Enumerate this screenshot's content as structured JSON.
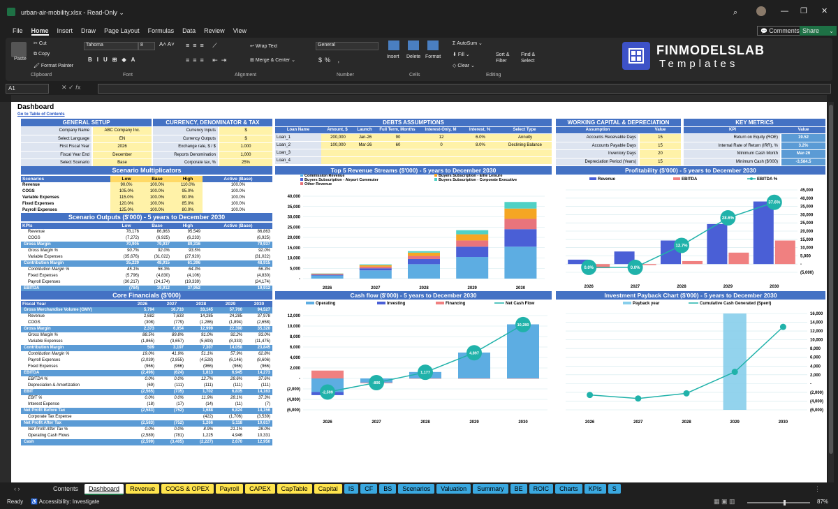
{
  "app": {
    "filename": "urban-air-mobility.xlsx",
    "mode": "Read-Only",
    "comments": "Comments",
    "share": "Share"
  },
  "menu": [
    "File",
    "Home",
    "Insert",
    "Draw",
    "Page Layout",
    "Formulas",
    "Data",
    "Review",
    "View"
  ],
  "ribbon": {
    "paste": "Paste",
    "cut": "Cut",
    "copy": "Copy",
    "format_painter": "Format Painter",
    "clipboard": "Clipboard",
    "font_name": "Tahoma",
    "font_size": "8",
    "font": "Font",
    "wrap": "Wrap Text",
    "merge": "Merge & Center",
    "alignment": "Alignment",
    "numfmt": "General",
    "number": "Number",
    "insert": "Insert",
    "delete": "Delete",
    "format": "Format",
    "cells": "Cells",
    "autosum": "AutoSum",
    "fill": "Fill",
    "clear": "Clear",
    "sort": "Sort & Filter",
    "find": "Find & Select",
    "editing": "Editing",
    "logo1": "FINMODELSLAB",
    "logo2": "Templates"
  },
  "formula": {
    "cellref": "A1"
  },
  "sheet": {
    "title": "Dashboard",
    "toc": "Go to Table of Contents",
    "gen_setup": {
      "title": "GENERAL SETUP",
      "rows": [
        [
          "Company Name",
          "ABC Company Inc."
        ],
        [
          "Select Language",
          "EN"
        ],
        [
          "First Fiscal Year",
          "2026"
        ],
        [
          "Fiscal Year End",
          "December"
        ],
        [
          "Select Scenario",
          "Base"
        ]
      ]
    },
    "currency": {
      "title": "CURRENCY, DENOMINATOR & TAX",
      "rows": [
        [
          "Currency Inputs",
          "$"
        ],
        [
          "Currency Outputs",
          "$"
        ],
        [
          "Exchange rate, $ / $",
          "1.000"
        ],
        [
          "Reports Denomination",
          "1,000"
        ],
        [
          "Corporate tax, %",
          "25%"
        ]
      ]
    },
    "debts": {
      "title": "DEBTS ASSUMPTIONS",
      "headers": [
        "Loan Name",
        "Amount, $",
        "Launch",
        "Full Term, Months",
        "Interest-Only, M",
        "Interest, %",
        "Select Type"
      ],
      "rows": [
        [
          "Loan_1",
          "200,000",
          "Jan-26",
          "90",
          "12",
          "6.0%",
          "Annuity"
        ],
        [
          "Loan_2",
          "100,000",
          "Mar-26",
          "60",
          "0",
          "8.0%",
          "Declining Balance"
        ],
        [
          "Loan_3",
          "",
          "",
          "",
          "",
          "",
          ""
        ],
        [
          "Loan_4",
          "",
          "",
          "",
          "",
          "",
          ""
        ]
      ]
    },
    "wc": {
      "title": "WORKING CAPITAL & DEPRECIATION",
      "headers": [
        "Assumption",
        "Value"
      ],
      "rows": [
        [
          "Accounts Receivable Days",
          "15"
        ],
        [
          "Accounts Payable Days",
          "15"
        ],
        [
          "Inventory Days",
          "20"
        ],
        [
          "Depreciation Period (Years)",
          "15"
        ]
      ]
    },
    "km": {
      "title": "KEY METRICS",
      "headers": [
        "KPI",
        "Value"
      ],
      "rows": [
        [
          "Return on Equity (ROE)",
          "19.52"
        ],
        [
          "Internal Rate of Return (IRR), %",
          "3.2%"
        ],
        [
          "Minimum Cash Month",
          "Mar-26"
        ],
        [
          "Minimum Cash ($'000)",
          "-3,584.5"
        ]
      ]
    },
    "sm": {
      "title": "Scenario Multiplicators",
      "headers": [
        "Scenarios",
        "Low",
        "Base",
        "High",
        "Active (Base)"
      ],
      "rows": [
        [
          "Revenue",
          "90.0%",
          "100.0%",
          "110.0%",
          "100.0%"
        ],
        [
          "COGS",
          "105.0%",
          "100.0%",
          "95.0%",
          "100.0%"
        ],
        [
          "Variable Expenses",
          "115.0%",
          "100.0%",
          "90.0%",
          "100.0%"
        ],
        [
          "Fixed Expenses",
          "120.0%",
          "100.0%",
          "85.0%",
          "100.0%"
        ],
        [
          "Payroll Expenses",
          "125.0%",
          "100.0%",
          "80.0%",
          "100.0%"
        ]
      ]
    },
    "so": {
      "title": "Scenario Outputs ($'000) - 5 years to December 2030",
      "headers": [
        "KPIs",
        "Low",
        "Base",
        "High",
        "Active (Base)"
      ],
      "rows": [
        [
          "Revenue",
          "78,176",
          "86,863",
          "95,549",
          "86,863",
          0
        ],
        [
          "COGS",
          "(7,272)",
          "(6,925)",
          "(6,233)",
          "(6,925)",
          0
        ],
        [
          "Gross Margin",
          "70,905",
          "79,937",
          "89,316",
          "79,937",
          1
        ],
        [
          "Gross Margin %",
          "90.7%",
          "92.0%",
          "93.5%",
          "92.0%",
          0
        ],
        [
          "Variable Expenses",
          "(35,676)",
          "(31,022)",
          "(27,920)",
          "(31,022)",
          0
        ],
        [
          "Contribution Margin",
          "35,229",
          "48,915",
          "61,396",
          "48,915",
          1
        ],
        [
          "Contribution Margin %",
          "45.1%",
          "56.3%",
          "64.3%",
          "56.3%",
          0
        ],
        [
          "Fixed Expenses",
          "(5,796)",
          "(4,830)",
          "(4,106)",
          "(4,830)",
          0
        ],
        [
          "Payroll Expenses",
          "(30,217)",
          "(24,174)",
          "(19,339)",
          "(24,174)",
          0
        ],
        [
          "EBITDA",
          "(784)",
          "19,912",
          "37,952",
          "19,912",
          1
        ],
        [
          "EBITDA %",
          "-1.0%",
          "22.9%",
          "39.7%",
          "22.9%",
          0
        ]
      ]
    },
    "cf": {
      "title": "Core Financials ($'000)",
      "headers": [
        "Fiscal Year",
        "2026",
        "2027",
        "2028",
        "2029",
        "2030"
      ],
      "rows": [
        [
          "Gross Merchandise Volume (GMV)",
          "5,794",
          "16,733",
          "33,145",
          "57,700",
          "94,527",
          1
        ],
        [
          "Revenue",
          "2,682",
          "7,633",
          "14,285",
          "24,285",
          "37,978",
          0
        ],
        [
          "COGS",
          "(308)",
          "(779)",
          "(1,286)",
          "(1,894)",
          "(2,658)",
          0
        ],
        [
          "Gross Margin",
          "2,373",
          "6,854",
          "12,999",
          "22,390",
          "35,320",
          1
        ],
        [
          "Gross Margin %",
          "88.5%",
          "89.8%",
          "91.0%",
          "92.2%",
          "93.0%",
          0
        ],
        [
          "Variable Expenses",
          "(1,865)",
          "(3,657)",
          "(5,693)",
          "(8,333)",
          "(11,475)",
          0
        ],
        [
          "Contribution Margin",
          "509",
          "3,197",
          "7,307",
          "14,058",
          "23,845",
          1
        ],
        [
          "Contribution Margin %",
          "19.0%",
          "41.9%",
          "51.1%",
          "57.9%",
          "62.8%",
          0
        ],
        [
          "Payroll Expenses",
          "(2,039)",
          "(2,855)",
          "(4,528)",
          "(6,146)",
          "(8,606)",
          0
        ],
        [
          "Fixed Expenses",
          "(966)",
          "(966)",
          "(966)",
          "(966)",
          "(966)",
          0
        ],
        [
          "EBITDA",
          "(2,496)",
          "(624)",
          "1,813",
          "6,945",
          "14,273",
          1
        ],
        [
          "EBITDA %",
          "0.0%",
          "0.0%",
          "12.7%",
          "28.6%",
          "37.6%",
          0
        ],
        [
          "Depreciation & Amortization",
          "(69)",
          "(111)",
          "(111)",
          "(111)",
          "(111)",
          0
        ],
        [
          "EBIT",
          "(2,565)",
          "(735)",
          "1,702",
          "6,835",
          "14,163",
          1
        ],
        [
          "EBIT %",
          "0.0%",
          "0.0%",
          "11.9%",
          "28.1%",
          "37.3%",
          0
        ],
        [
          "Interest Expense",
          "(18)",
          "(17)",
          "(14)",
          "(11)",
          "(7)",
          0
        ],
        [
          "Net Profit Before Tax",
          "(2,583)",
          "(752)",
          "1,688",
          "6,824",
          "14,156",
          1
        ],
        [
          "Corporate Tax Expense",
          "",
          "",
          "(422)",
          "(1,706)",
          "(3,539)",
          0
        ],
        [
          "Net Profit After Tax",
          "(2,583)",
          "(752)",
          "1,266",
          "5,118",
          "10,617",
          1
        ],
        [
          "Net Profit After Tax %",
          "0.0%",
          "0.0%",
          "8.9%",
          "21.1%",
          "28.0%",
          0
        ],
        [
          "Operating Cash Flows",
          "(2,589)",
          "(781)",
          "1,225",
          "4,946",
          "10,331",
          0
        ],
        [
          "Cash",
          "(2,599)",
          "(3,405)",
          "(2,227)",
          "2,670",
          "12,950",
          1
        ]
      ]
    }
  },
  "tabs": [
    "Contents",
    "Dashboard",
    "Revenue",
    "COGS & OPEX",
    "Payroll",
    "CAPEX",
    "CapTable",
    "Capital",
    "IS",
    "CF",
    "BS",
    "Scenarios",
    "Valuation",
    "Summary",
    "BE",
    "ROIC",
    "Charts",
    "KPIs",
    "S"
  ],
  "status": {
    "ready": "Ready",
    "access": "Accessibility: Investigate",
    "zoom": "87%"
  },
  "chart_data": [
    {
      "type": "bar",
      "title": "Top 5 Revenue Streams ($'000) - 5 years to December 2030",
      "categories": [
        "2026",
        "2027",
        "2028",
        "2029",
        "2030"
      ],
      "ylim": [
        0,
        40000
      ],
      "yticks": [
        "40,000",
        "35,000",
        "30,000",
        "25,000",
        "20,000",
        "15,000",
        "10,000",
        "5,000",
        "-"
      ],
      "series": [
        {
          "name": "Commission Revenue",
          "color": "#5dade2",
          "values": [
            1500,
            4000,
            7000,
            10500,
            15500
          ]
        },
        {
          "name": "Buyers Subscription - Airport Commuter",
          "color": "#4a5fd6",
          "values": [
            400,
            1000,
            2500,
            5000,
            8500
          ]
        },
        {
          "name": "Other Revenue",
          "color": "#e8747c",
          "values": [
            300,
            800,
            1500,
            3000,
            5000
          ]
        },
        {
          "name": "Buyers Subscription - Elite Leisure",
          "color": "#f5a623",
          "values": [
            200,
            700,
            1600,
            3000,
            5000
          ]
        },
        {
          "name": "Buyers Subscription - Corporate Executive",
          "color": "#4fd1c5",
          "values": [
            100,
            400,
            700,
            2000,
            3200
          ]
        }
      ]
    },
    {
      "type": "bar",
      "title": "Profitability ($'000) - 5 years to December 2030",
      "categories": [
        "2026",
        "2027",
        "2028",
        "2029",
        "2030"
      ],
      "ylim": [
        -5000,
        45000
      ],
      "yticks": [
        "45,000",
        "40,000",
        "35,000",
        "30,000",
        "25,000",
        "20,000",
        "15,000",
        "10,000",
        "5,000",
        "-",
        "(5,000)"
      ],
      "series": [
        {
          "name": "Revenue",
          "color": "#4a5fd6",
          "values": [
            2682,
            7633,
            14285,
            24285,
            37978
          ]
        },
        {
          "name": "EBITDA",
          "color": "#f08080",
          "values": [
            -2496,
            -624,
            1813,
            6945,
            14273
          ]
        },
        {
          "name": "EBITDA %",
          "color": "#20b2aa",
          "values": [
            0.0,
            0.0,
            12.7,
            28.6,
            37.6
          ],
          "labels": [
            "0.0%",
            "0.0%",
            "12.7%",
            "28.6%",
            "37.6%"
          ]
        }
      ]
    },
    {
      "type": "bar",
      "title": "Cash flow ($'000) - 5 years to December 2030",
      "categories": [
        "2026",
        "2027",
        "2028",
        "2029",
        "2030"
      ],
      "ylim": [
        -6000,
        12000
      ],
      "yticks": [
        "12,000",
        "10,000",
        "8,000",
        "6,000",
        "4,000",
        "2,000",
        "-",
        "(2,000)",
        "(4,000)",
        "(6,000)"
      ],
      "series": [
        {
          "name": "Operating",
          "color": "#5dade2",
          "values": [
            -2589,
            -781,
            1225,
            4946,
            10331
          ]
        },
        {
          "name": "Investing",
          "color": "#4a5fd6",
          "values": [
            -600,
            -40,
            0,
            0,
            0
          ]
        },
        {
          "name": "Financing",
          "color": "#f08080",
          "values": [
            1500,
            -100,
            -60,
            -60,
            -60
          ]
        },
        {
          "name": "Net Cash Flow",
          "color": "#20b2aa",
          "values": [
            -2599,
            -806,
            1177,
            4897,
            10280
          ],
          "labels": [
            "-2,599",
            "-806",
            "1,177",
            "4,897",
            "10,280"
          ]
        }
      ]
    },
    {
      "type": "line",
      "title": "Investment Payback Chart ($'000) - 5 years to December 2030",
      "categories": [
        "2026",
        "2027",
        "2028",
        "2029",
        "2030"
      ],
      "ylim": [
        -6000,
        16000
      ],
      "yticks": [
        "16,000",
        "14,000",
        "12,000",
        "10,000",
        "8,000",
        "6,000",
        "4,000",
        "2,000",
        "-",
        "(2,000)",
        "(4,000)",
        "(6,000)"
      ],
      "series": [
        {
          "name": "Payback year",
          "color": "#87ceeb",
          "values": [
            0,
            0,
            0,
            1,
            0
          ]
        },
        {
          "name": "Cumulative Cash Generated (Spent)",
          "color": "#20b2aa",
          "values": [
            -2599,
            -3405,
            -2227,
            2670,
            12950
          ]
        }
      ]
    }
  ]
}
